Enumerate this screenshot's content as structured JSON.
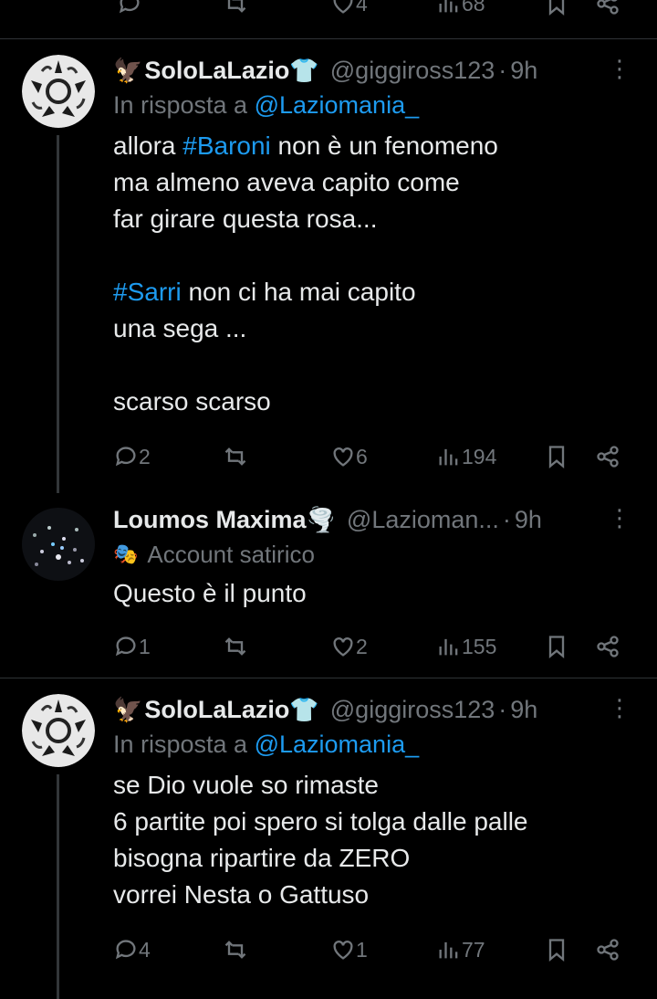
{
  "top_actions": {
    "likes": "4",
    "views": "68"
  },
  "tweets": [
    {
      "name": "SoloLaLazio",
      "prefix_emoji": "🦅",
      "suffix_emoji": "👕",
      "handle": "@giggiross123",
      "dot": "·",
      "time": "9h",
      "reply_prefix": "In risposta a",
      "reply_to": "@Laziomania_",
      "lines": [
        [
          "allora ",
          "#Baroni",
          " non è un fenomeno"
        ],
        "ma almeno aveva capito come",
        "far girare questa rosa...",
        "",
        [
          "",
          "#Sarri",
          " non ci ha mai capito"
        ],
        "una sega ...",
        "",
        "scarso scarso"
      ],
      "replies": "2",
      "retweets": "",
      "likes": "6",
      "views": "194"
    },
    {
      "name": "Loumos Maxima",
      "suffix_emoji": "🌪️",
      "handle": "@Lazioman...",
      "dot": "·",
      "time": "9h",
      "badge_icon": "🎭",
      "badge": "Account satirico",
      "text": "Questo è il punto",
      "replies": "1",
      "retweets": "",
      "likes": "2",
      "views": "155"
    },
    {
      "name": "SoloLaLazio",
      "prefix_emoji": "🦅",
      "suffix_emoji": "👕",
      "handle": "@giggiross123",
      "dot": "·",
      "time": "9h",
      "reply_prefix": "In risposta a",
      "reply_to": "@Laziomania_",
      "text": "se Dio vuole so rimaste\n6 partite poi spero si tolga dalle palle\nbisogna ripartire da ZERO\nvorrei Nesta o Gattuso",
      "replies": "4",
      "retweets": "",
      "likes": "1",
      "views": "77"
    }
  ],
  "colors": {
    "background": "#000000",
    "text": "#e7e9ea",
    "muted": "#71767b",
    "link": "#1d9bf0",
    "divider": "#2f3336"
  }
}
